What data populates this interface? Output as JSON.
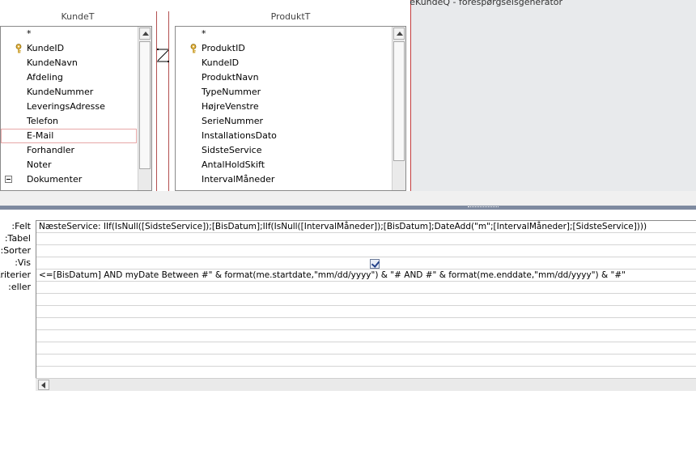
{
  "window": {
    "title": "ProduktListeKundeQ - forespørgselsgenerator"
  },
  "tables": [
    {
      "name": "KundeT",
      "fields": [
        {
          "label": "*",
          "key": false,
          "collapse": false
        },
        {
          "label": "KundeID",
          "key": true,
          "collapse": false
        },
        {
          "label": "KundeNavn",
          "key": false,
          "collapse": false
        },
        {
          "label": "Afdeling",
          "key": false,
          "collapse": false
        },
        {
          "label": "KundeNummer",
          "key": false,
          "collapse": false
        },
        {
          "label": "LeveringsAdresse",
          "key": false,
          "collapse": false
        },
        {
          "label": "Telefon",
          "key": false,
          "collapse": false
        },
        {
          "label": "E-Mail",
          "key": false,
          "collapse": false,
          "selected": true
        },
        {
          "label": "Forhandler",
          "key": false,
          "collapse": false
        },
        {
          "label": "Noter",
          "key": false,
          "collapse": false
        },
        {
          "label": "Dokumenter",
          "key": false,
          "collapse": true
        }
      ]
    },
    {
      "name": "ProduktT",
      "fields": [
        {
          "label": "*",
          "key": false
        },
        {
          "label": "ProduktID",
          "key": true
        },
        {
          "label": "KundeID",
          "key": false
        },
        {
          "label": "ProduktNavn",
          "key": false
        },
        {
          "label": "TypeNummer",
          "key": false
        },
        {
          "label": "HøjreVenstre",
          "key": false
        },
        {
          "label": "SerieNummer",
          "key": false
        },
        {
          "label": "InstallationsDato",
          "key": false
        },
        {
          "label": "SidsteService",
          "key": false
        },
        {
          "label": "AntalHoldSkift",
          "key": false
        },
        {
          "label": "IntervalMåneder",
          "key": false
        }
      ]
    }
  ],
  "grid": {
    "row_labels": [
      "Felt:",
      "Tabel:",
      "Sorter:",
      "Vis:",
      "Kriterier:",
      "eller:"
    ],
    "field_value": "NæsteService: IIf(IsNull([SidsteService]);[BisDatum];IIf(IsNull([IntervalMåneder]);[BisDatum];DateAdd(\"m\";[IntervalMåneder];[SidsteService])))",
    "table_value": "",
    "sort_value": "",
    "show_checked": true,
    "criteria_value": "<=[BisDatum] AND myDate Between #\" & format(me.startdate,\"mm/dd/yyyy\") & \"# AND #\" & format(me.enddate,\"mm/dd/yyyy\") & \"#\"",
    "or_value": ""
  }
}
